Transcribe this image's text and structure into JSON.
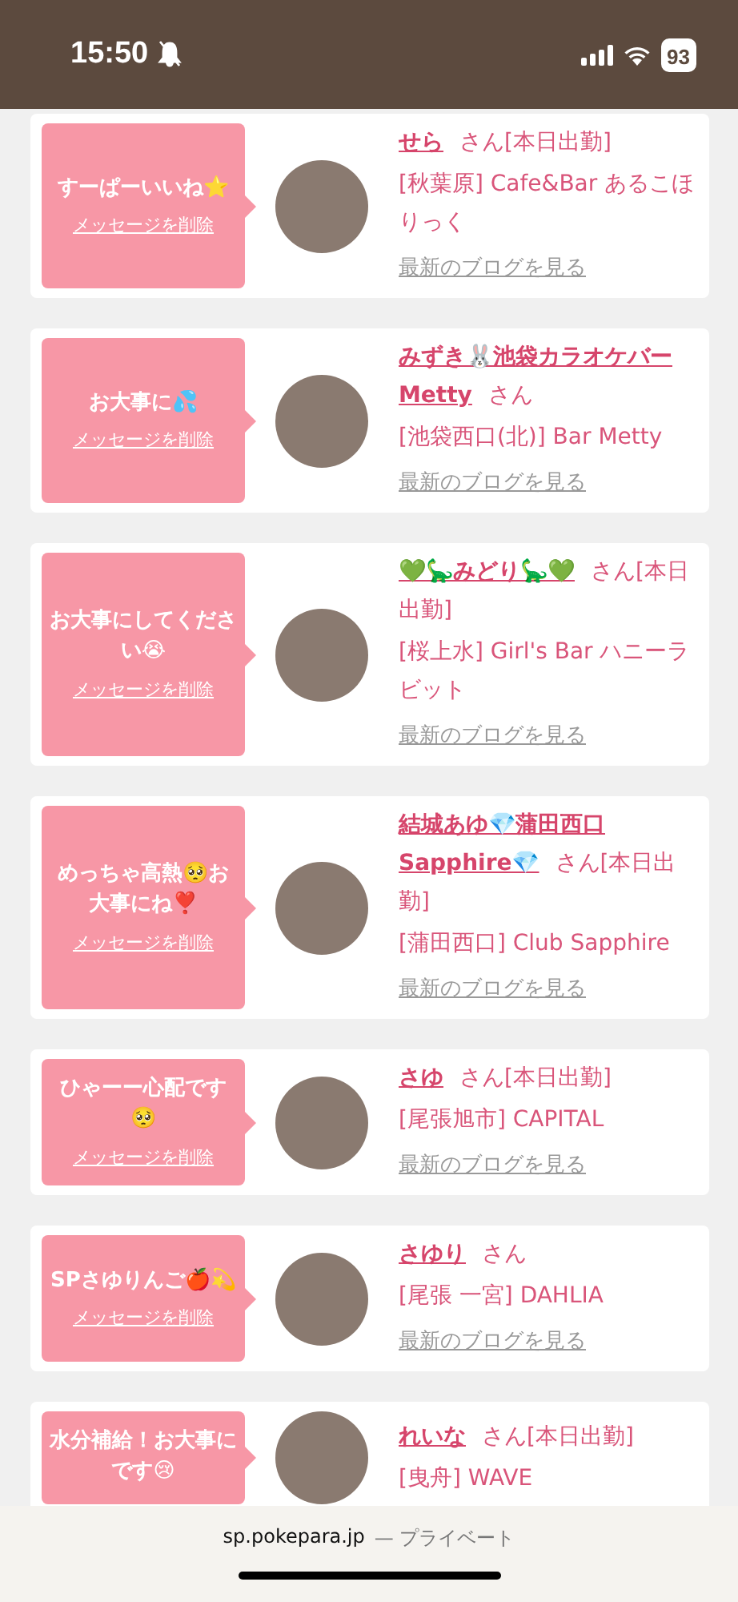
{
  "status_bar": {
    "time": "15:50",
    "battery": "93"
  },
  "messages": [
    {
      "message": "すーぱーいいね⭐",
      "delete_label": "メッセージを削除",
      "name": "せら",
      "honorific": "さん",
      "status": "[本日出勤]",
      "location": "[秋葉原] Cafe&Bar あるこほりっく",
      "blog_link": "最新のブログを見る"
    },
    {
      "message": "お大事に💦",
      "delete_label": "メッセージを削除",
      "name": "みずき🐰池袋カラオケバーMetty",
      "honorific": "さん",
      "location": "[池袋西口(北)] Bar Metty",
      "blog_link": "最新のブログを見る"
    },
    {
      "message": "お大事にしてください😭",
      "delete_label": "メッセージを削除",
      "name": "💚🦕みどり🦕💚",
      "honorific": "さん",
      "status": "[本日出勤]",
      "location": "[桜上水] Girl's Bar ハニーラビット",
      "blog_link": "最新のブログを見る"
    },
    {
      "message": "めっちゃ高熱🥺お大事にね❣️",
      "delete_label": "メッセージを削除",
      "name": "結城あゆ💎蒲田西口Sapphire💎",
      "honorific": "さん",
      "status": "[本日出勤]",
      "location": "[蒲田西口] Club Sapphire",
      "blog_link": "最新のブログを見る"
    },
    {
      "message": "ひゃーー心配です🥺",
      "delete_label": "メッセージを削除",
      "name": "さゆ",
      "honorific": "さん",
      "status": "[本日出勤]",
      "location": "[尾張旭市] CAPITAL",
      "blog_link": "最新のブログを見る"
    },
    {
      "message": "SPさゆりんご🍎💫",
      "delete_label": "メッセージを削除",
      "name": "さゆり",
      "honorific": "さん",
      "location": "[尾張 一宮] DAHLIA",
      "blog_link": "最新のブログを見る"
    },
    {
      "message": "水分補給！お大事にです😢",
      "name": "れいな",
      "honorific": "さん",
      "status": "[本日出勤]",
      "location": "[曳舟] WAVE"
    }
  ],
  "browser_bar": {
    "domain": "sp.pokepara.jp",
    "mode": "— プライベート"
  }
}
